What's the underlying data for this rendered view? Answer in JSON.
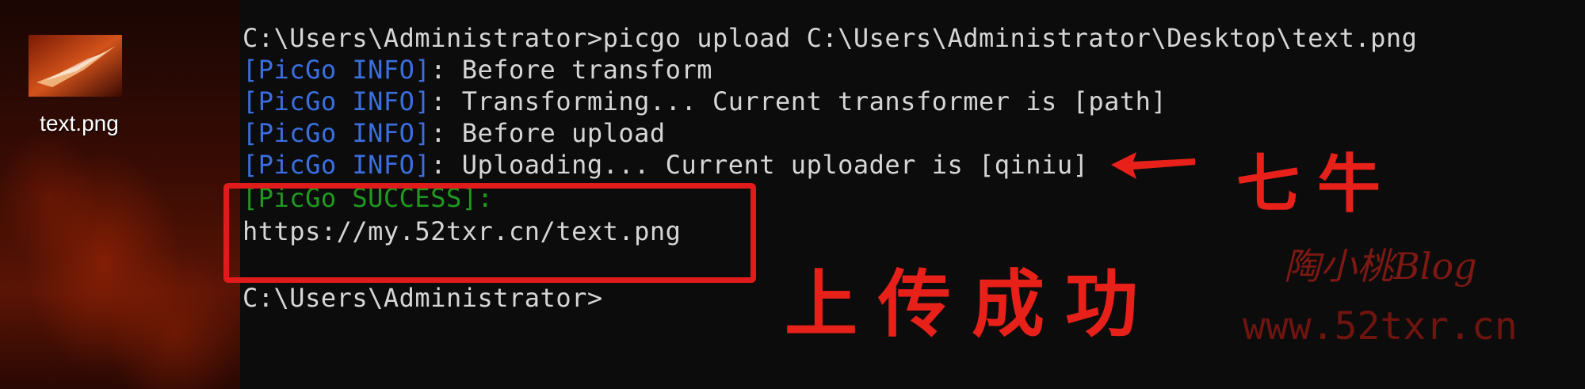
{
  "desktop": {
    "file_name": "text.png",
    "icon": "image-file-icon"
  },
  "terminal": {
    "command_line": "C:\\Users\\Administrator>picgo upload C:\\Users\\Administrator\\Desktop\\text.png",
    "logs": [
      {
        "tag": "[PicGo INFO]",
        "message": ": Before transform"
      },
      {
        "tag": "[PicGo INFO]",
        "message": ": Transforming... Current transformer is [path]"
      },
      {
        "tag": "[PicGo INFO]",
        "message": ": Before upload"
      },
      {
        "tag": "[PicGo INFO]",
        "message": ": Uploading... Current uploader is [qiniu]"
      }
    ],
    "success_tag": "[PicGo SUCCESS]",
    "success_suffix": ":",
    "result_url": "https://my.52txr.cn/text.png",
    "prompt": "C:\\Users\\Administrator>"
  },
  "annotations": {
    "uploader_note": "七牛",
    "success_note": "上传成功",
    "arrow_icon": "arrow-left-icon",
    "color": "#e01b1b"
  },
  "watermark": {
    "name": "陶小桃Blog",
    "url": "www.52txr.cn"
  },
  "colors": {
    "info": "#3a6fe0",
    "success": "#1f9a1f",
    "text": "#d6d6d6",
    "background": "#0c0c0c"
  }
}
